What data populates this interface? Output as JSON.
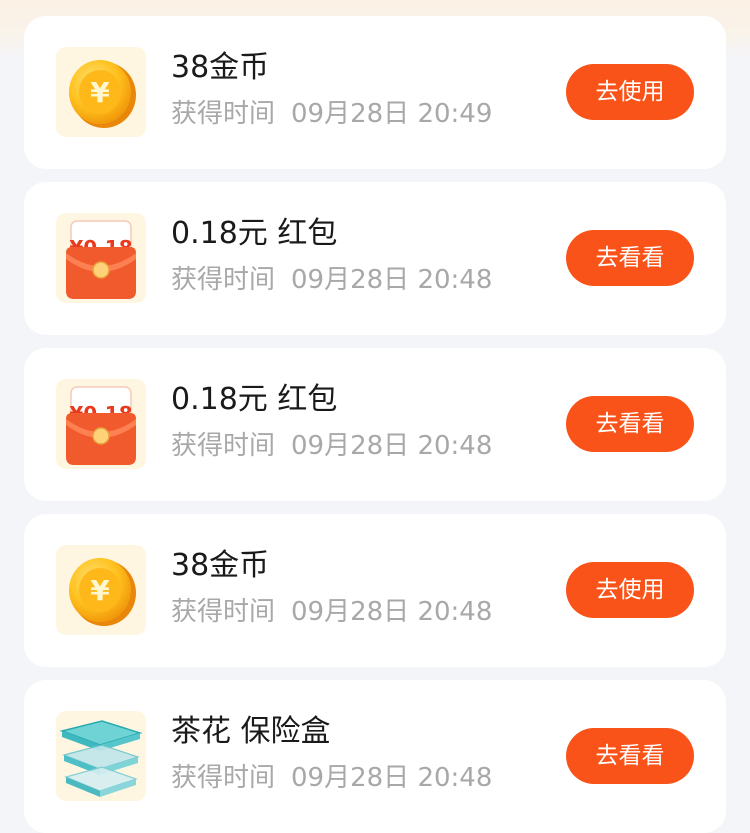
{
  "items": [
    {
      "icon": "gold-coin-icon",
      "title": "38金币",
      "time_label": "获得时间",
      "time": "09月28日 20:49",
      "action": "去使用"
    },
    {
      "icon": "red-packet-icon",
      "icon_text": "¥0.18",
      "title": "0.18元 红包",
      "time_label": "获得时间",
      "time": "09月28日 20:48",
      "action": "去看看"
    },
    {
      "icon": "red-packet-icon",
      "icon_text": "¥0.18",
      "title": "0.18元 红包",
      "time_label": "获得时间",
      "time": "09月28日 20:48",
      "action": "去看看"
    },
    {
      "icon": "gold-coin-icon",
      "title": "38金币",
      "time_label": "获得时间",
      "time": "09月28日 20:48",
      "action": "去使用"
    },
    {
      "icon": "storage-box-icon",
      "title": "茶花 保险盒",
      "time_label": "获得时间",
      "time": "09月28日 20:48",
      "action": "去看看"
    }
  ],
  "colors": {
    "page_background": "#f4f5f9",
    "card_background": "#ffffff",
    "button": "#fa5319",
    "button_text": "#ffffff",
    "title_text": "#1a1a1a",
    "meta_text": "#a8a8a8"
  }
}
